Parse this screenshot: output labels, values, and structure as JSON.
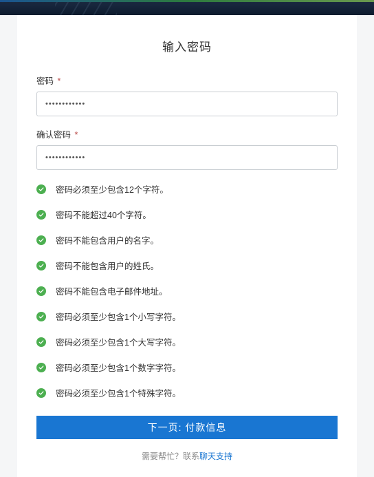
{
  "title": "输入密码",
  "form": {
    "password_label": "密码",
    "password_value": "••••••••••••",
    "confirm_label": "确认密码",
    "confirm_value": "••••••••••••",
    "required_mark": "*"
  },
  "rules": [
    "密码必须至少包含12个字符。",
    "密码不能超过40个字符。",
    "密码不能包含用户的名字。",
    "密码不能包含用户的姓氏。",
    "密码不能包含电子邮件地址。",
    "密码必须至少包含1个小写字符。",
    "密码必须至少包含1个大写字符。",
    "密码必须至少包含1个数字字符。",
    "密码必须至少包含1个特殊字符。"
  ],
  "button": {
    "next_label": "下一页: 付款信息"
  },
  "help": {
    "prefix": "需要帮忙？联系",
    "link": "聊天支持"
  }
}
